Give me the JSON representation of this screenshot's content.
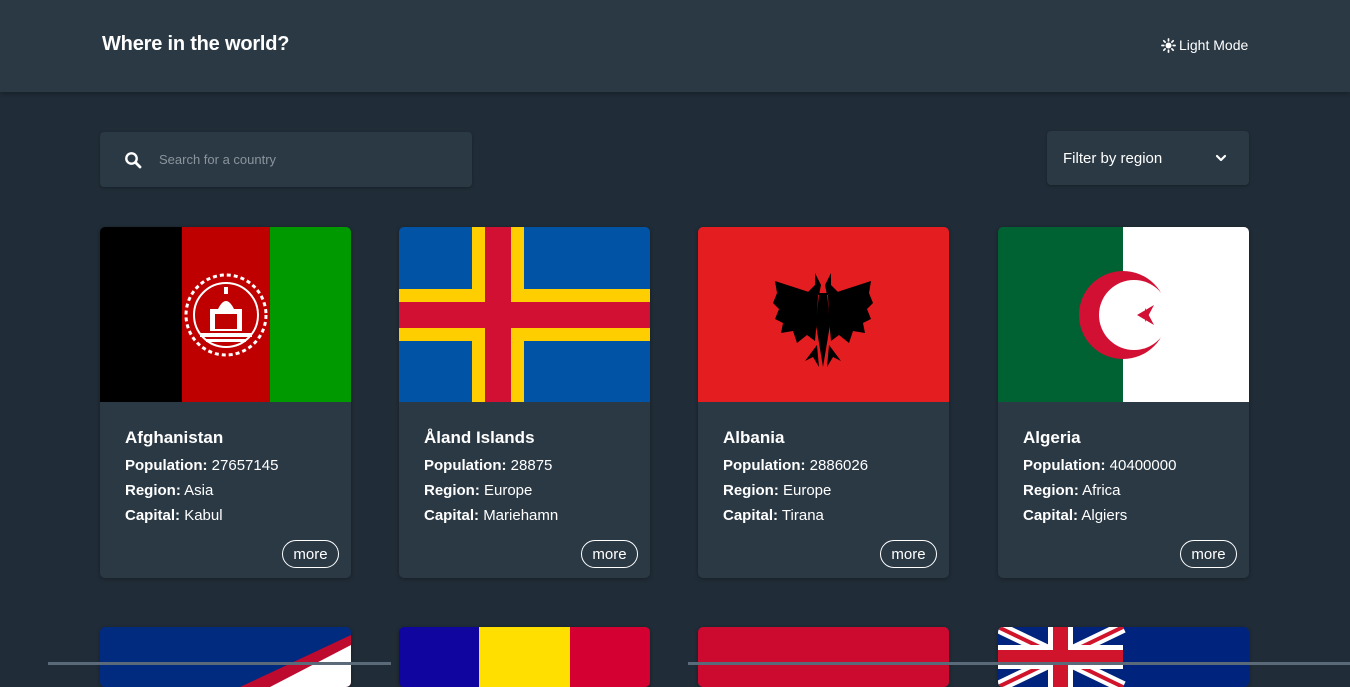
{
  "header": {
    "title": "Where in the world?",
    "mode_label": "Light Mode",
    "mode_icon": "sun-icon"
  },
  "search": {
    "placeholder": "Search for a country",
    "value": "",
    "icon": "search-icon"
  },
  "filter": {
    "label": "Filter by region",
    "icon": "chevron-down-icon"
  },
  "labels": {
    "population": "Population:",
    "region": "Region:",
    "capital": "Capital:",
    "more": "more"
  },
  "countries": [
    {
      "name": "Afghanistan",
      "population": "27657145",
      "region": "Asia",
      "capital": "Kabul"
    },
    {
      "name": "Åland Islands",
      "population": "28875",
      "region": "Europe",
      "capital": "Mariehamn"
    },
    {
      "name": "Albania",
      "population": "2886026",
      "region": "Europe",
      "capital": "Tirana"
    },
    {
      "name": "Algeria",
      "population": "40400000",
      "region": "Africa",
      "capital": "Algiers"
    }
  ],
  "colors": {
    "background": "#202c37",
    "elements": "#2b3945",
    "text": "#ffffff"
  }
}
